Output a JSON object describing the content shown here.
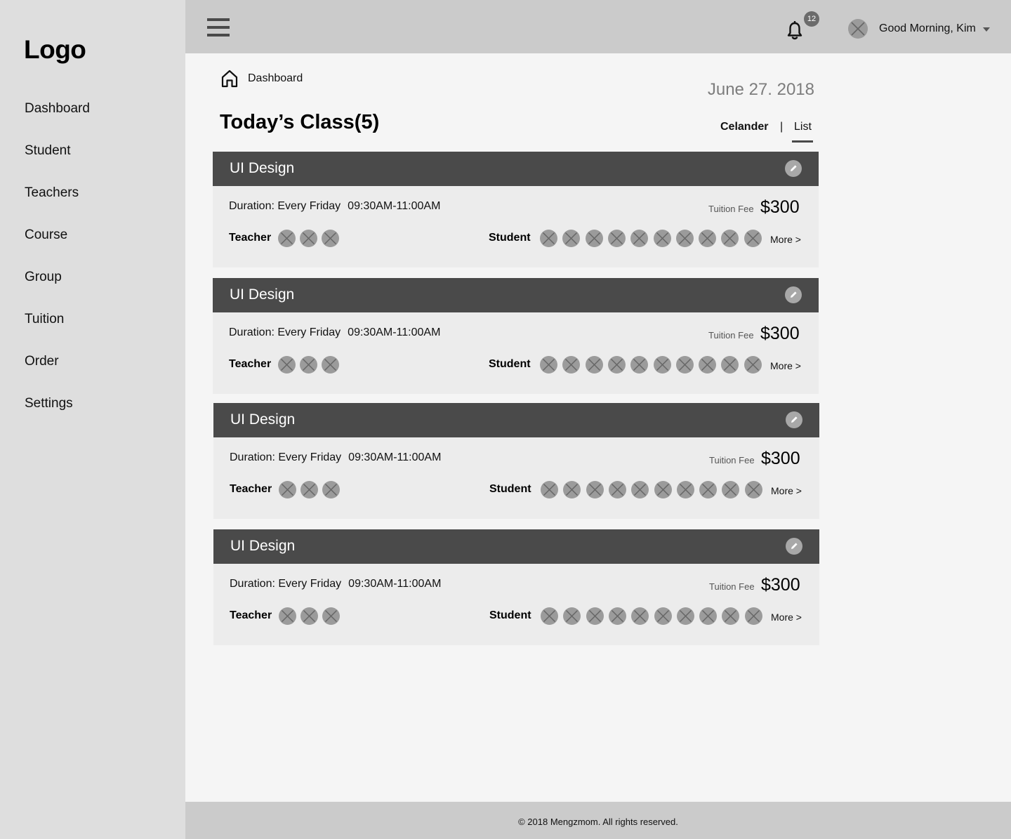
{
  "sidebar": {
    "logo": "Logo",
    "items": [
      {
        "label": "Dashboard"
      },
      {
        "label": "Student"
      },
      {
        "label": "Teachers"
      },
      {
        "label": "Course"
      },
      {
        "label": "Group"
      },
      {
        "label": "Tuition"
      },
      {
        "label": "Order"
      },
      {
        "label": "Settings"
      }
    ]
  },
  "header": {
    "menu_icon": "hamburger-menu-icon",
    "notifications_icon": "bell-icon",
    "notification_count": "12",
    "greeting": "Good Morning, Kim",
    "avatar_icon": "avatar-placeholder-icon",
    "dropdown_icon": "caret-down-icon"
  },
  "breadcrumb": {
    "icon": "home-icon",
    "label": "Dashboard"
  },
  "date": "June 27. 2018",
  "page_title": "Today’s Class(5)",
  "view_tabs": {
    "calendar": "Celander",
    "separator": "|",
    "list": "List",
    "active": "List"
  },
  "classes": [
    {
      "title": "UI Design",
      "duration": "Duration: Every Friday",
      "time": "09:30AM-11:00AM",
      "fee_label": "Tuition Fee",
      "fee": "$300",
      "teacher_label": "Teacher",
      "teacher_count": 3,
      "student_label": "Student",
      "student_count": 10,
      "more": "More >"
    },
    {
      "title": "UI Design",
      "duration": "Duration: Every Friday",
      "time": "09:30AM-11:00AM",
      "fee_label": "Tuition Fee",
      "fee": "$300",
      "teacher_label": "Teacher",
      "teacher_count": 3,
      "student_label": "Student",
      "student_count": 10,
      "more": "More >"
    },
    {
      "title": "UI Design",
      "duration": "Duration: Every Friday",
      "time": "09:30AM-11:00AM",
      "fee_label": "Tuition Fee",
      "fee": "$300",
      "teacher_label": "Teacher",
      "teacher_count": 3,
      "student_label": "Student",
      "student_count": 10,
      "more": "More >"
    },
    {
      "title": "UI Design",
      "duration": "Duration: Every Friday",
      "time": "09:30AM-11:00AM",
      "fee_label": "Tuition Fee",
      "fee": "$300",
      "teacher_label": "Teacher",
      "teacher_count": 3,
      "student_label": "Student",
      "student_count": 10,
      "more": "More >"
    }
  ],
  "footer": "© 2018 Mengzmom. All rights reserved.",
  "colors": {
    "sidebar_bg": "#dedede",
    "topbar_bg": "#cbcbcb",
    "content_bg": "#f5f5f5",
    "card_header": "#4a4a4a",
    "card_body": "#ececec",
    "date_text": "#7d7d7d"
  }
}
